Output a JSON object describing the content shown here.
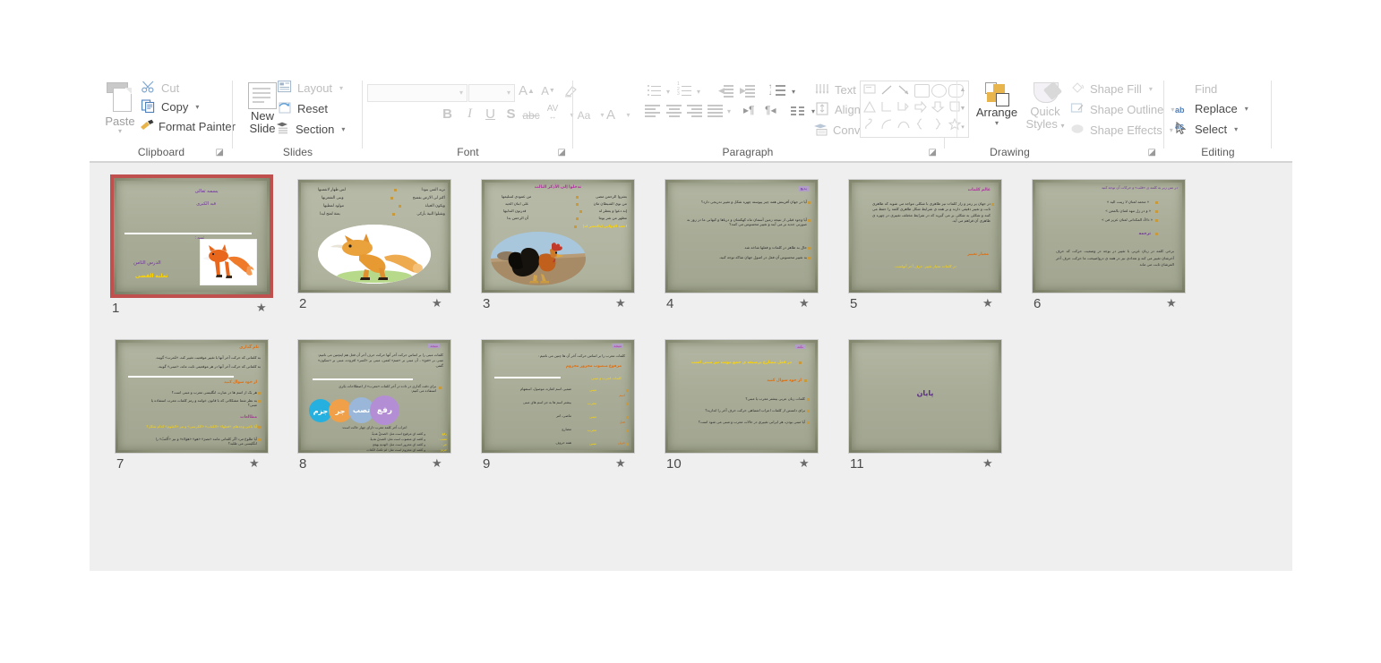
{
  "app": {
    "name": "Microsoft PowerPoint",
    "view": "slide-sorter"
  },
  "ribbon": {
    "groups": [
      {
        "name": "Clipboard",
        "label": "Clipboard",
        "has_dialog_launcher": true,
        "items": [
          {
            "label": "Paste",
            "icon": "paste-icon",
            "enabled": true,
            "has_caret": true
          },
          {
            "label": "Cut",
            "icon": "scissors-icon",
            "enabled": false,
            "has_caret": false
          },
          {
            "label": "Copy",
            "icon": "copy-icon",
            "enabled": true,
            "has_caret": true
          },
          {
            "label": "Format Painter",
            "icon": "format-painter-icon",
            "enabled": true,
            "has_caret": false
          }
        ]
      },
      {
        "name": "Slides",
        "label": "Slides",
        "has_dialog_launcher": false,
        "items": [
          {
            "label": "New Slide",
            "icon": "new-slide-icon",
            "enabled": true,
            "has_caret": true
          },
          {
            "label": "Layout",
            "icon": "layout-icon",
            "enabled": true,
            "has_caret": true
          },
          {
            "label": "Reset",
            "icon": "reset-icon",
            "enabled": true,
            "has_caret": false
          },
          {
            "label": "Section",
            "icon": "section-icon",
            "enabled": true,
            "has_caret": true
          }
        ]
      },
      {
        "name": "Font",
        "label": "Font",
        "has_dialog_launcher": true,
        "enabled": false,
        "font_name_value": "",
        "font_size_value": "",
        "items": [
          {
            "label": "Increase Font Size",
            "icon": "increase-font-size-icon"
          },
          {
            "label": "Decrease Font Size",
            "icon": "decrease-font-size-icon"
          },
          {
            "label": "Clear All Formatting",
            "icon": "clear-formatting-icon"
          },
          {
            "label": "Bold",
            "icon": "bold-icon",
            "glyph": "B"
          },
          {
            "label": "Italic",
            "icon": "italic-icon",
            "glyph": "I"
          },
          {
            "label": "Underline",
            "icon": "underline-icon",
            "glyph": "U"
          },
          {
            "label": "Text Shadow",
            "icon": "text-shadow-icon",
            "glyph": "S"
          },
          {
            "label": "Strikethrough",
            "icon": "strikethrough-icon",
            "glyph": "abc"
          },
          {
            "label": "Character Spacing",
            "icon": "character-spacing-icon",
            "glyph": "AV"
          },
          {
            "label": "Change Case",
            "icon": "change-case-icon",
            "glyph": "Aa"
          },
          {
            "label": "Font Color",
            "icon": "font-color-icon",
            "glyph": "A"
          }
        ]
      },
      {
        "name": "Paragraph",
        "label": "Paragraph",
        "has_dialog_launcher": true,
        "items": [
          {
            "label": "Bullets",
            "icon": "bullets-icon",
            "enabled": false
          },
          {
            "label": "Numbering",
            "icon": "numbering-icon",
            "enabled": false
          },
          {
            "label": "Decrease List Level",
            "icon": "decrease-indent-icon",
            "enabled": false
          },
          {
            "label": "Increase List Level",
            "icon": "increase-indent-icon",
            "enabled": false
          },
          {
            "label": "Line Spacing",
            "icon": "line-spacing-icon",
            "enabled": false
          },
          {
            "label": "Text Direction",
            "icon": "text-direction-icon",
            "enabled": false,
            "has_caret": true
          },
          {
            "label": "Align Text",
            "icon": "align-text-icon",
            "enabled": false,
            "has_caret": true
          },
          {
            "label": "Convert to SmartArt",
            "icon": "convert-to-smartart-icon",
            "enabled": false,
            "has_caret": true
          },
          {
            "label": "Align Left",
            "icon": "align-left-icon",
            "enabled": false
          },
          {
            "label": "Center",
            "icon": "align-center-icon",
            "enabled": false
          },
          {
            "label": "Align Right",
            "icon": "align-right-icon",
            "enabled": false
          },
          {
            "label": "Justify",
            "icon": "justify-icon",
            "enabled": false
          },
          {
            "label": "Left-to-Right Text Direction",
            "icon": "ltr-icon",
            "enabled": false
          },
          {
            "label": "Right-to-Left Text Direction",
            "icon": "rtl-icon",
            "enabled": false
          },
          {
            "label": "Columns",
            "icon": "columns-icon",
            "enabled": false,
            "has_caret": true
          }
        ]
      },
      {
        "name": "Drawing",
        "label": "Drawing",
        "has_dialog_launcher": true,
        "items": [
          {
            "label": "Shapes Gallery",
            "icon": "shapes-gallery-icon",
            "enabled": true
          },
          {
            "label": "Arrange",
            "icon": "arrange-icon",
            "enabled": true,
            "has_caret": true
          },
          {
            "label": "Quick Styles",
            "icon": "quick-styles-icon",
            "enabled": false,
            "has_caret": true
          },
          {
            "label": "Shape Fill",
            "icon": "shape-fill-icon",
            "enabled": false,
            "has_caret": true
          },
          {
            "label": "Shape Outline",
            "icon": "shape-outline-icon",
            "enabled": false,
            "has_caret": true
          },
          {
            "label": "Shape Effects",
            "icon": "shape-effects-icon",
            "enabled": false,
            "has_caret": true
          }
        ]
      },
      {
        "name": "Editing",
        "label": "Editing",
        "has_dialog_launcher": false,
        "items": [
          {
            "label": "Find",
            "icon": "find-icon",
            "enabled": false,
            "has_caret": false
          },
          {
            "label": "Replace",
            "icon": "replace-icon",
            "enabled": true,
            "has_caret": true
          },
          {
            "label": "Select",
            "icon": "select-icon",
            "enabled": true,
            "has_caret": true
          }
        ]
      }
    ]
  },
  "slide_pane": {
    "selected_slide": 1,
    "animation_marker": "★",
    "slides": [
      {
        "number": "1",
        "has_animation": true,
        "selected": true,
        "lines": [
          {
            "text": "بسمه تعالی",
            "color": "#7030a0"
          },
          {
            "text": "قبه الکبری",
            "color": "#7030a0"
          },
          {
            "text": "تهیه :",
            "color": "#7030a0"
          },
          {
            "text": "الدرس الثامن",
            "color": "#7030a0"
          },
          {
            "text": "ثعلبة الفضی",
            "color": "#ffd500"
          }
        ],
        "has_fox_image": true
      },
      {
        "number": "2",
        "has_animation": true,
        "selected": false,
        "bullets_right": [
          "ترید الفتن بنودا",
          "اکثر لی الارض بفسح",
          "ویکون الحیاة",
          "وتقبلوا النیة بأزکی"
        ],
        "lines_left": [
          "لس ظهار لانفسها",
          "وبنی الشعریها",
          "مولود لمطیها",
          "بعثة لعثج لیدا"
        ],
        "has_fox_image": true
      },
      {
        "number": "3",
        "has_animation": true,
        "selected": false,
        "title": "تدخلوا إلی الأذکر الثالث",
        "bullets_right": [
          "بشروا الرحمن مضی",
          "من نوی الشیطان مان",
          "إنه دعوا و یعطر له",
          "مطهر من شر یوما",
          "احمد الدوانی (بالعصر له)"
        ],
        "lines_left": [
          "من عمودی لسلیمها",
          "علی ابنان الحید",
          "قدرتون الندلیها",
          "أن الرحمن بدا"
        ],
        "has_rooster_image": true
      },
      {
        "number": "4",
        "has_animation": true,
        "selected": false,
        "title": "بدیع",
        "bullets": [
          "آیا در جهان آفرینش همه چیز پیوسته چهره شکل و تغییر تدریجی دارد؟",
          "آیا وجود قبلی از نتیجه زمین آسمان ماه کهکشان و دریاها و کیهانی ما در روز به صورتی جدید بر می آیند و تغییر محسوس می کنند؟",
          "حال به ظاهر در کلمات و فعلها شاخه شد",
          "به تغییر محسوس آن فعل در اصول جهان شاکه توجه کنید."
        ]
      },
      {
        "number": "5",
        "has_animation": true,
        "selected": false,
        "title": "عالم کلمات",
        "body": "در جهان پر رمز و راز کلمات نیز ظاهری با شکلی مواجه می شوید که ظاهری ثابت و تغییر دقیقی دارند و بر همه ی شرایط شکل ظاهری کلمه را حفظ می کنند و شکلی به شکلی بر می گیرید که در شرایط مختلف تغییری در چهره ی ظاهری آن فراهم می آید.",
        "subtitle": "معیار تغییر",
        "note": "در کلمات معیار تغییر: حرف آخر آنهاست."
      },
      {
        "number": "6",
        "has_animation": true,
        "selected": false,
        "title": "در متن زیر به کلمه ی «قلب» و حرکات آن توجه کنید",
        "bullets": [
          "« محمد لعنان لا زینت الیه »",
          "« و در زل تنهد لعنان بالمعن »",
          "« دالأذ المکداتی لعنان عزیز فی »"
        ],
        "sub": "ترجمه",
        "body": "برخی کلمه در زبان عربی با تغییر در بوجه در وضعیت حرکت که حرف آخرشان تغییر می کند و تعدادی نیز در همه ی درواضیحت ما حرکت حرف آخر الفرشان ثابت می ماند"
      },
      {
        "number": "7",
        "has_animation": true,
        "selected": false,
        "title": "نام گذاری",
        "lines": [
          "به کلماتی که حرکت آخر آنها با تغییر موقعیت تغییر کند، «مُعرب» گویند.",
          "به کلماتی که حرکت آخر آنها در هر موقعیتی ثابت ماند، «مبنی» گویند."
        ],
        "sub1": "از خود سوال کنید",
        "q": [
          "هر یک از اسم ها در عبارت انگلیسی معرب و مبنی است؟",
          "به نظر شما مشکلاتی که با قانون خوانند و رمز کلمات معرب استفاده یا مبنی؟"
        ],
        "sub2": "مطالعات",
        "q2": [
          "آیا باجی وجدهای «فعلها» «الکتاب» «الکرسی» و نیز «العلوم» کدام شکل؟",
          "آیا طلوع مرد اگر کلماتی مانند «نصرَ» «هو» «هؤلاء» و نیز «أَکتبُ» را انگلیسی می طلبد؟"
        ]
      },
      {
        "number": "8",
        "has_animation": true,
        "selected": false,
        "title": "نتیجه",
        "body": "کلمات مبنی را بر اساس حرکت آخر آنها حرکت حرف آخر آن فعل هم اینچنین می نامیم: مبنی بر «فتح» ، آن مبنی بر «ضم» لعمن، مبنی بر «کسر» افزوده، مبنی بر «سکون» گفتی.",
        "note": "برای دقت گذاری در داده در آخر کلمات «معرب» از اصطلاحات بکری استفاده می کنیم:",
        "circles": [
          {
            "label": "رفع",
            "color": "#b48ed4"
          },
          {
            "label": "تصب",
            "color": "#9ab6d9"
          },
          {
            "label": "جر",
            "color": "#f0a048"
          },
          {
            "label": "جزم",
            "color": "#25b0e0"
          }
        ],
        "footer": "اعراب آخر کلمه معرب دارای چهار حالت است:",
        "rows": [
          {
            "k": "رفع:",
            "v": "و کلمه ای مرفوع است مثل: الصدقُ هدیةٌ"
          },
          {
            "k": "نصب :",
            "v": "و کلمه ای منصوب است مثل: الصدقَ هدیةً"
          },
          {
            "k": "جر :",
            "v": "و کلمه ای مجرور است مثل: الهدیةِ بهجةٍ"
          },
          {
            "k": "جزم:",
            "v": "و کلمه ای مجزوم است مثل: لم تکتبْ الکتابَ"
          }
        ]
      },
      {
        "number": "9",
        "has_animation": true,
        "selected": false,
        "title": "نتیجه",
        "subtitle": "کلمات معرب را بر اساس حرکت آخر آن ها چنین می نامیم :",
        "heading": "مرفوع منصوب مجرور مجزوم",
        "table_header": "کلمات مُعرب و مبنی",
        "rows": [
          {
            "cat": "اسم",
            "type": "مبنی",
            "desc": "ضمیر، اسم اشاره، موصول، استفهام"
          },
          {
            "cat": "",
            "type": "معرب",
            "desc": "بیشتر اسم ها به جز اسم های مبنی"
          },
          {
            "cat": "فعل",
            "type": "مبنی",
            "desc": "ماضی، امر"
          },
          {
            "cat": "",
            "type": "معرب",
            "desc": "مضارع"
          },
          {
            "cat": "حرف",
            "type": "مبنی",
            "desc": "همه حروف"
          }
        ]
      },
      {
        "number": "10",
        "has_animation": true,
        "selected": false,
        "title": "نکته",
        "highlight": "در فعل مضارع برصیغه ی جمع مونث نیز مبنی است",
        "subtitle": "از خود سوال کنید",
        "bullets": [
          "کلمات زبان عربی بیشتر معرب یا مبنی؟",
          "برای دانستن از کلمات اعراب اشتباهی حرکت حرف آخر را اندازید؟",
          "آیا مبنی بودن، هر ایرانی تغییری در حالات معرب و مبنی می شود است؟"
        ]
      },
      {
        "number": "11",
        "has_animation": true,
        "selected": false,
        "end_text": "پایان"
      }
    ]
  },
  "colors": {
    "selection_border": "#c0504d",
    "pane_background": "#efefef",
    "slide_background": "#a8ac97",
    "ribbon_background": "#ffffff",
    "accent_yellow": "#ffd500",
    "accent_purple": "#7030a0",
    "accent_orange": "#e36c0a"
  }
}
